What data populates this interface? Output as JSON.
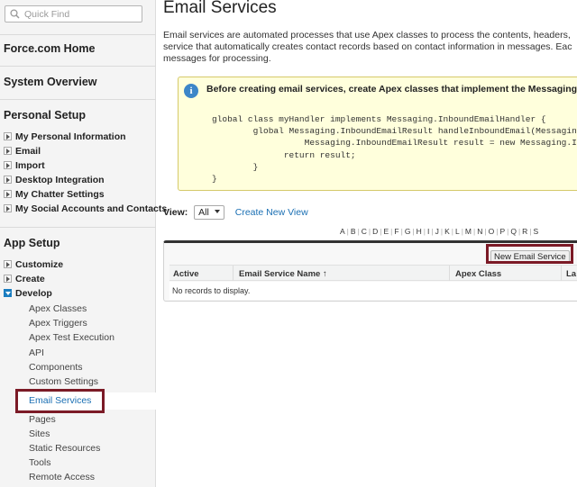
{
  "sidebar": {
    "search": {
      "placeholder": "Quick Find",
      "value": ""
    },
    "sections": [
      {
        "title": "Force.com Home"
      },
      {
        "title": "System Overview"
      },
      {
        "title": "Personal Setup"
      },
      {
        "title": "App Setup"
      }
    ],
    "personal_setup_items": [
      {
        "label": "My Personal Information"
      },
      {
        "label": "Email"
      },
      {
        "label": "Import"
      },
      {
        "label": "Desktop Integration"
      },
      {
        "label": "My Chatter Settings"
      },
      {
        "label": "My Social Accounts and Contacts"
      }
    ],
    "app_setup_items": [
      {
        "label": "Customize"
      },
      {
        "label": "Create"
      },
      {
        "label": "Develop"
      }
    ],
    "develop_subitems": [
      {
        "label": "Apex Classes"
      },
      {
        "label": "Apex Triggers"
      },
      {
        "label": "Apex Test Execution"
      },
      {
        "label": "API"
      },
      {
        "label": "Components"
      },
      {
        "label": "Custom Settings"
      },
      {
        "label": "Email Services"
      },
      {
        "label": "Pages"
      },
      {
        "label": "Sites"
      },
      {
        "label": "Static Resources"
      },
      {
        "label": "Tools"
      },
      {
        "label": "Remote Access"
      }
    ],
    "active_item": "Email Services"
  },
  "main": {
    "title": "Email Services",
    "description": [
      "Email services are automated processes that use Apex classes to process the contents, headers,",
      "service that automatically creates contact records based on contact information in messages. Eac",
      "messages for processing."
    ],
    "info": {
      "heading": "Before creating email services, create Apex classes that implement the Messaging.Inbou",
      "code": "global class myHandler implements Messaging.InboundEmailHandler {\n        global Messaging.InboundEmailResult handleInboundEmail(Messaging\n                  Messaging.InboundEmailResult result = new Messaging.Inbo\n              return result;\n        }\n}"
    },
    "view": {
      "label": "View:",
      "selected": "All",
      "create_link": "Create New View"
    },
    "alphabet": [
      "A",
      "B",
      "C",
      "D",
      "E",
      "F",
      "G",
      "H",
      "I",
      "J",
      "K",
      "L",
      "M",
      "N",
      "O",
      "P",
      "Q",
      "R",
      "S"
    ],
    "table": {
      "new_button": "New Email Service",
      "columns": [
        "Active",
        "Email Service Name ↑",
        "Apex Class",
        "La"
      ],
      "empty_message": "No records to display."
    }
  },
  "colors": {
    "accent_link": "#1a6fb3",
    "highlight_box": "#7b1a26",
    "info_bg": "#ffffdc"
  }
}
